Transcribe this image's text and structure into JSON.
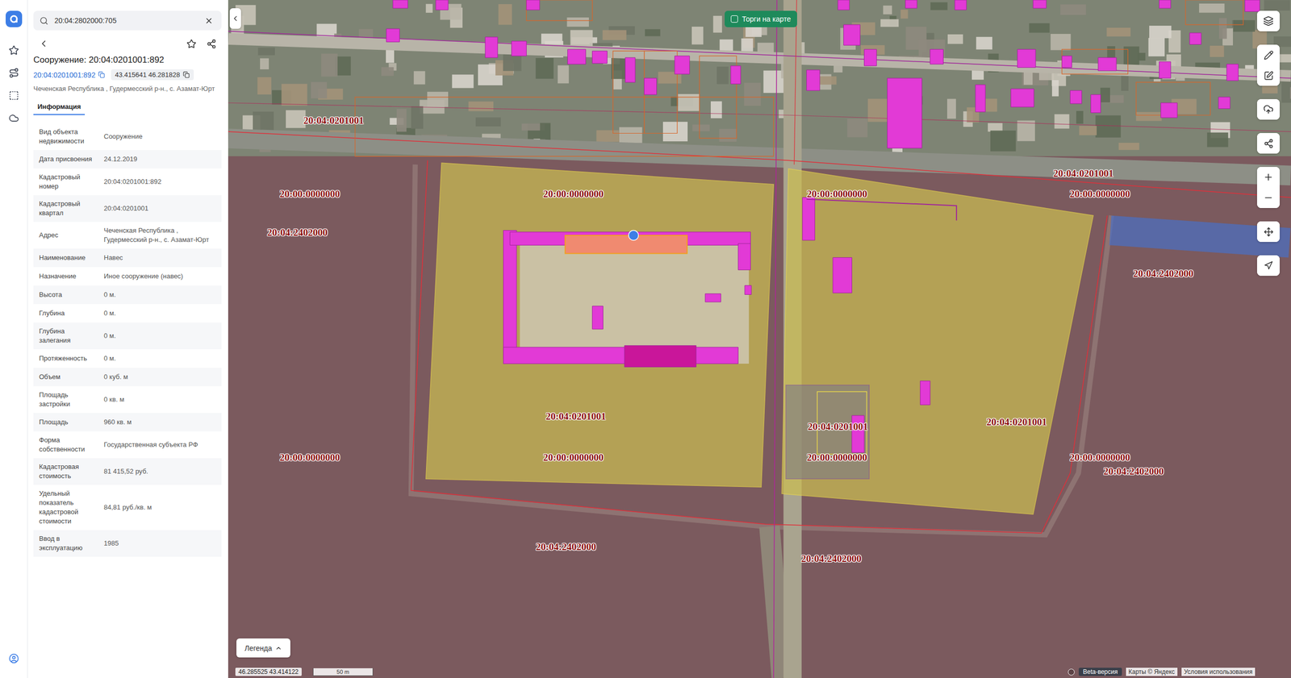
{
  "search": {
    "value": "20:04:2802000:705"
  },
  "object": {
    "title": "Сооружение: 20:04:0201001:892",
    "link": "20:04:0201001:892",
    "coords": "43.415641 46.281828",
    "address": "Чеченская Республика , Гудермесский р-н., с. Азамат-Юрт"
  },
  "tabs": [
    {
      "label": "Информация",
      "selected": true
    }
  ],
  "info_rows": [
    {
      "label": "Вид объекта недвижимости",
      "value": "Сооружение"
    },
    {
      "label": "Дата присвоения",
      "value": "24.12.2019"
    },
    {
      "label": "Кадастровый номер",
      "value": "20:04:0201001:892"
    },
    {
      "label": "Кадастровый квартал",
      "value": "20:04:0201001"
    },
    {
      "label": "Адрес",
      "value": "Чеченская Республика , Гудермесский р-н., с. Азамат-Юрт"
    },
    {
      "label": "Наименование",
      "value": "Навес"
    },
    {
      "label": "Назначение",
      "value": "Иное сооружение (навес)"
    },
    {
      "label": "Высота",
      "value": "0 м."
    },
    {
      "label": "Глубина",
      "value": "0 м."
    },
    {
      "label": "Глубина залегания",
      "value": "0 м."
    },
    {
      "label": "Протяженность",
      "value": "0 м."
    },
    {
      "label": "Объем",
      "value": "0 куб. м"
    },
    {
      "label": "Площадь застройки",
      "value": "0 кв. м"
    },
    {
      "label": "Площадь",
      "value": "960 кв. м"
    },
    {
      "label": "Форма собственности",
      "value": "Государственная субъекта РФ"
    },
    {
      "label": "Кадастровая стоимость",
      "value": "81 415,52 руб."
    },
    {
      "label": "Удельный показатель кадастровой стоимости",
      "value": "84,81 руб./кв. м"
    },
    {
      "label": "Ввод в эксплуатацию",
      "value": "1985"
    }
  ],
  "map": {
    "auction_toggle": {
      "label": "Торги на карте",
      "checked": false
    },
    "labels": [
      {
        "text": "20:04:0201001"
      },
      {
        "text": "20:00:0000000"
      },
      {
        "text": "20:04:2402000"
      },
      {
        "text": "20:00:0000000"
      },
      {
        "text": "20:00:0000000"
      },
      {
        "text": "20:04:0201001"
      },
      {
        "text": "20:00:0000000"
      },
      {
        "text": "20:04:2402000"
      },
      {
        "text": "20:04:0201001"
      },
      {
        "text": "20:00:0000000"
      },
      {
        "text": "20:00:0000000"
      },
      {
        "text": "20:04:0201001"
      },
      {
        "text": "20:00:0000000"
      },
      {
        "text": "20:04:0201001"
      },
      {
        "text": "20:00:0000000"
      },
      {
        "text": "20:04:2402000"
      },
      {
        "text": "20:04:2402000"
      },
      {
        "text": "20:04:2402000"
      }
    ],
    "legend": {
      "label": "Легенда",
      "expanded": false
    },
    "cursor_coords": "46.285525 43.414122",
    "scale": "50 m",
    "attribution": {
      "beta": "Beta-версия",
      "maps": "Карты © Яндекс",
      "terms": "Условия использования"
    }
  }
}
